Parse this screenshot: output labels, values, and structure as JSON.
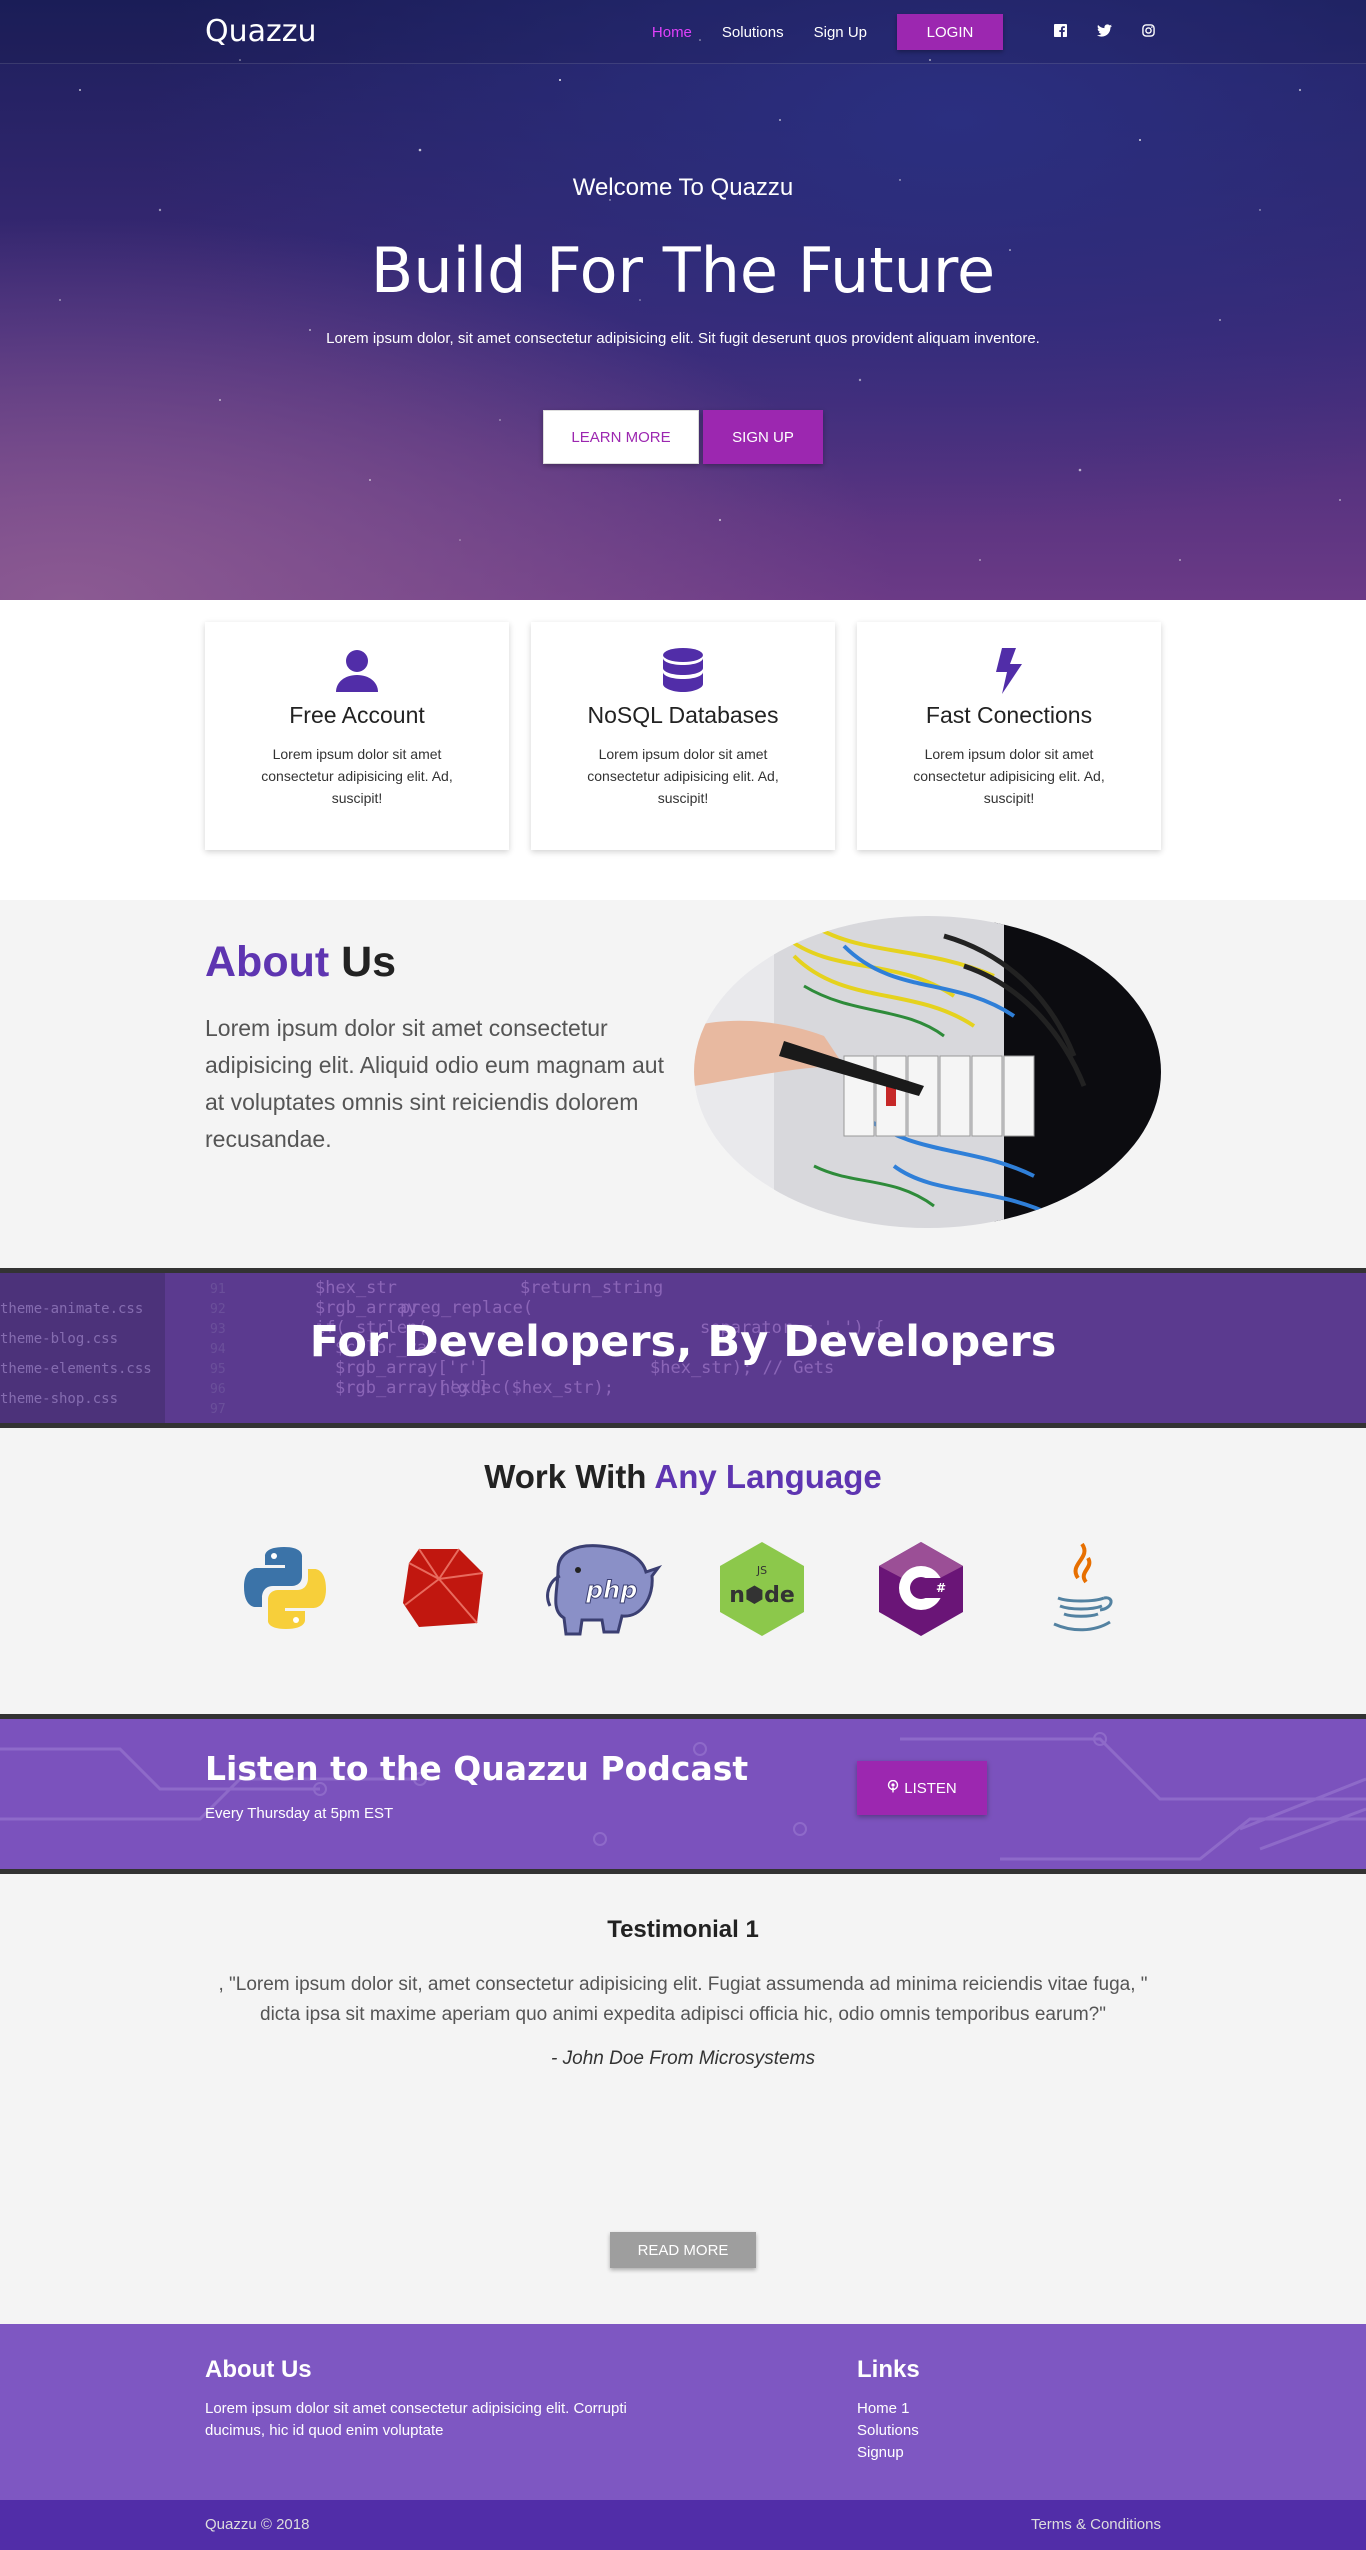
{
  "nav": {
    "brand": "Quazzu",
    "links": [
      "Home",
      "Solutions",
      "Sign Up"
    ],
    "login": "LOGIN",
    "social_icons": [
      "facebook-icon",
      "twitter-icon",
      "instagram-icon"
    ]
  },
  "hero": {
    "subtitle": "Welcome To Quazzu",
    "title": "Build For The Future",
    "text": "Lorem ipsum dolor, sit amet consectetur adipisicing elit. Sit fugit deserunt quos provident aliquam inventore.",
    "learn_more": "LEARN MORE",
    "sign_up": "SIGN UP"
  },
  "features": [
    {
      "icon": "user-icon",
      "title": "Free Account",
      "text": "Lorem ipsum dolor sit amet consectetur adipisicing elit. Ad, suscipit!"
    },
    {
      "icon": "database-icon",
      "title": "NoSQL Databases",
      "text": "Lorem ipsum dolor sit amet consectetur adipisicing elit. Ad, suscipit!"
    },
    {
      "icon": "bolt-icon",
      "title": "Fast Conections",
      "text": "Lorem ipsum dolor sit amet consectetur adipisicing elit. Ad, suscipit!"
    }
  ],
  "about": {
    "title_accent": "About",
    "title_rest": "Us",
    "text": "Lorem ipsum dolor sit amet consectetur adipisicing elit. Aliquid odio eum magnam aut at voluptates omnis sint reiciendis dolorem recusandae."
  },
  "dev_banner": {
    "title": "For Developers, By Developers"
  },
  "languages": {
    "title_start": "Work With",
    "title_accent": "Any Language",
    "icons": [
      "python-logo-icon",
      "ruby-logo-icon",
      "php-logo-icon",
      "nodejs-logo-icon",
      "csharp-logo-icon",
      "java-logo-icon"
    ]
  },
  "podcast": {
    "title": "Listen to the Quazzu Podcast",
    "subtitle": "Every Thursday at 5pm EST",
    "button": "LISTEN"
  },
  "testimonial": {
    "title": "Testimonial 1",
    "quote": ", \"Lorem ipsum dolor sit, amet consectetur adipisicing elit. Fugiat assumenda ad minima reiciendis vitae fuga, \" dicta ipsa sit maxime aperiam quo animi expedita adipisci officia hic, odio omnis temporibus earum?\"",
    "author": "- John Doe From Microsystems",
    "read_more": "READ MORE"
  },
  "footer": {
    "about_title": "About Us",
    "about_text": "Lorem ipsum dolor sit amet consectetur adipisicing elit. Corrupti ducimus, hic id quod enim voluptate",
    "links_title": "Links",
    "links": [
      "Home 1",
      "Solutions",
      "Signup"
    ],
    "copyright": "Quazzu © 2018",
    "terms": "Terms & Conditions"
  },
  "colors": {
    "accent_purple": "#9c27b0",
    "deep_purple": "#5e35b1",
    "footer_purple": "#7e57c2",
    "bottom_bar": "#512da8",
    "nav_active": "#e040fb"
  }
}
